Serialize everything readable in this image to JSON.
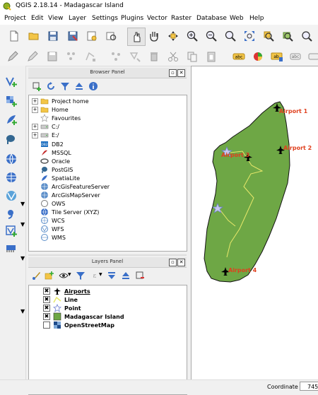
{
  "window": {
    "title": "QGIS 2.18.14 - Madagascar Island"
  },
  "menu": [
    "Project",
    "Edit",
    "View",
    "Layer",
    "Settings",
    "Plugins",
    "Vector",
    "Raster",
    "Database",
    "Web",
    "Help"
  ],
  "browser_panel": {
    "title": "Browser Panel",
    "items": [
      {
        "label": "Project home",
        "icon": "folder-icon",
        "expandable": true
      },
      {
        "label": "Home",
        "icon": "folder-icon",
        "expandable": true
      },
      {
        "label": "Favourites",
        "icon": "star-icon",
        "expandable": false
      },
      {
        "label": "C:/",
        "icon": "drive-icon",
        "expandable": true
      },
      {
        "label": "E:/",
        "icon": "drive-icon",
        "expandable": true
      },
      {
        "label": "DB2",
        "icon": "db2-icon",
        "expandable": false
      },
      {
        "label": "MSSQL",
        "icon": "mssql-icon",
        "expandable": false
      },
      {
        "label": "Oracle",
        "icon": "oracle-icon",
        "expandable": false
      },
      {
        "label": "PostGIS",
        "icon": "postgis-icon",
        "expandable": false
      },
      {
        "label": "SpatiaLite",
        "icon": "spatialite-icon",
        "expandable": false
      },
      {
        "label": "ArcGisFeatureServer",
        "icon": "arcgis-icon",
        "expandable": false
      },
      {
        "label": "ArcGisMapServer",
        "icon": "arcgis-icon",
        "expandable": false
      },
      {
        "label": "OWS",
        "icon": "ows-icon",
        "expandable": false
      },
      {
        "label": "Tile Server (XYZ)",
        "icon": "tile-server-icon",
        "expandable": false
      },
      {
        "label": "WCS",
        "icon": "wcs-icon",
        "expandable": false
      },
      {
        "label": "WFS",
        "icon": "wfs-icon",
        "expandable": false
      },
      {
        "label": "WMS",
        "icon": "wms-icon",
        "expandable": false
      }
    ]
  },
  "layers_panel": {
    "title": "Layers Panel",
    "layers": [
      {
        "label": "Airports",
        "checked": true,
        "icon": "airport-icon",
        "underlined": true
      },
      {
        "label": "Line",
        "checked": true,
        "icon": "line-icon",
        "underlined": false
      },
      {
        "label": "Point",
        "checked": true,
        "icon": "star-icon",
        "underlined": false
      },
      {
        "label": "Madagascar Island",
        "checked": true,
        "icon": "polygon-fill-icon",
        "underlined": false
      },
      {
        "label": "OpenStreetMap",
        "checked": false,
        "icon": "osm-raster-icon",
        "underlined": false
      }
    ]
  },
  "map": {
    "airport_labels": [
      "Airport 1",
      "Airport 2",
      "Airport 3",
      "Airport 4"
    ],
    "island_color": "#6ea745",
    "label_color": "#e0401e",
    "line_color": "#e8e86a"
  },
  "status_bar": {
    "coordinate_label": "Coordinate",
    "coordinate_value": "745"
  }
}
